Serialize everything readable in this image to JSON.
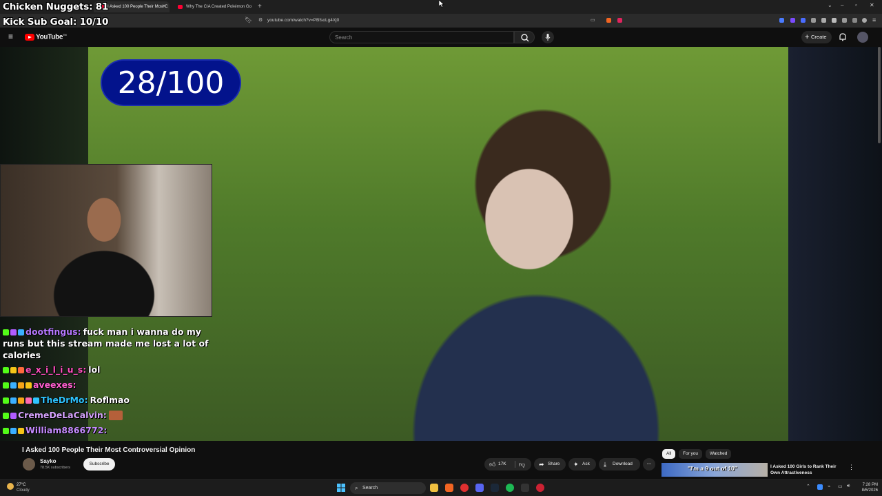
{
  "browser": {
    "tabs": [
      {
        "label": "I Asked 100 People Their Most C",
        "active": true
      },
      {
        "label": "Why The CIA Created Pokémon Go",
        "active": false
      }
    ],
    "url": "youtube.com/watch?v=PBfsoLg4Xj0"
  },
  "stream_overlay": {
    "line1": "Chicken Nuggets: 81",
    "line2": "Kick Sub Goal: 10/10",
    "counter": "28/100"
  },
  "youtube": {
    "logo_text": "YouTube",
    "logo_sup": "TM",
    "search_placeholder": "Search",
    "create_label": "Create"
  },
  "chat": [
    {
      "user": "dootfingus:",
      "user_color": "#b678ff",
      "message": "fuck man i wanna do my runs but this stream made me lost a lot of calories"
    },
    {
      "user": "e_x_i_l_i_u_s:",
      "user_color": "#ff4fbf",
      "message": "lol"
    },
    {
      "user": "aveexes:",
      "user_color": "#ff5fcf",
      "message": ""
    },
    {
      "user": "TheDrMo:",
      "user_color": "#2ec4ff",
      "message": "Roflmao"
    },
    {
      "user": "CremeDeLaCalvin:",
      "user_color": "#d7a4ff",
      "message": ""
    },
    {
      "user": "William8866772:",
      "user_color": "#c58cff",
      "message": ""
    }
  ],
  "video": {
    "title": "I Asked 100 People Their Most Controversial Opinion",
    "channel": "Sayko",
    "subscribers": "78.5K subscribers",
    "subscribe_label": "Subscribe",
    "likes": "17K",
    "share_label": "Share",
    "ask_label": "Ask",
    "download_label": "Download"
  },
  "recommendations": {
    "chips": [
      "All",
      "For you",
      "Watched"
    ],
    "first": {
      "thumb_text": "\"I'm a 9 out of 10\"",
      "title": "I Asked 100 Girls to Rank Their Own Attractiveness"
    }
  },
  "taskbar": {
    "weather_temp": "27°C",
    "weather_desc": "Cloudy",
    "search_label": "Search",
    "time": "7:28 PM",
    "date": "8/6/2026"
  }
}
